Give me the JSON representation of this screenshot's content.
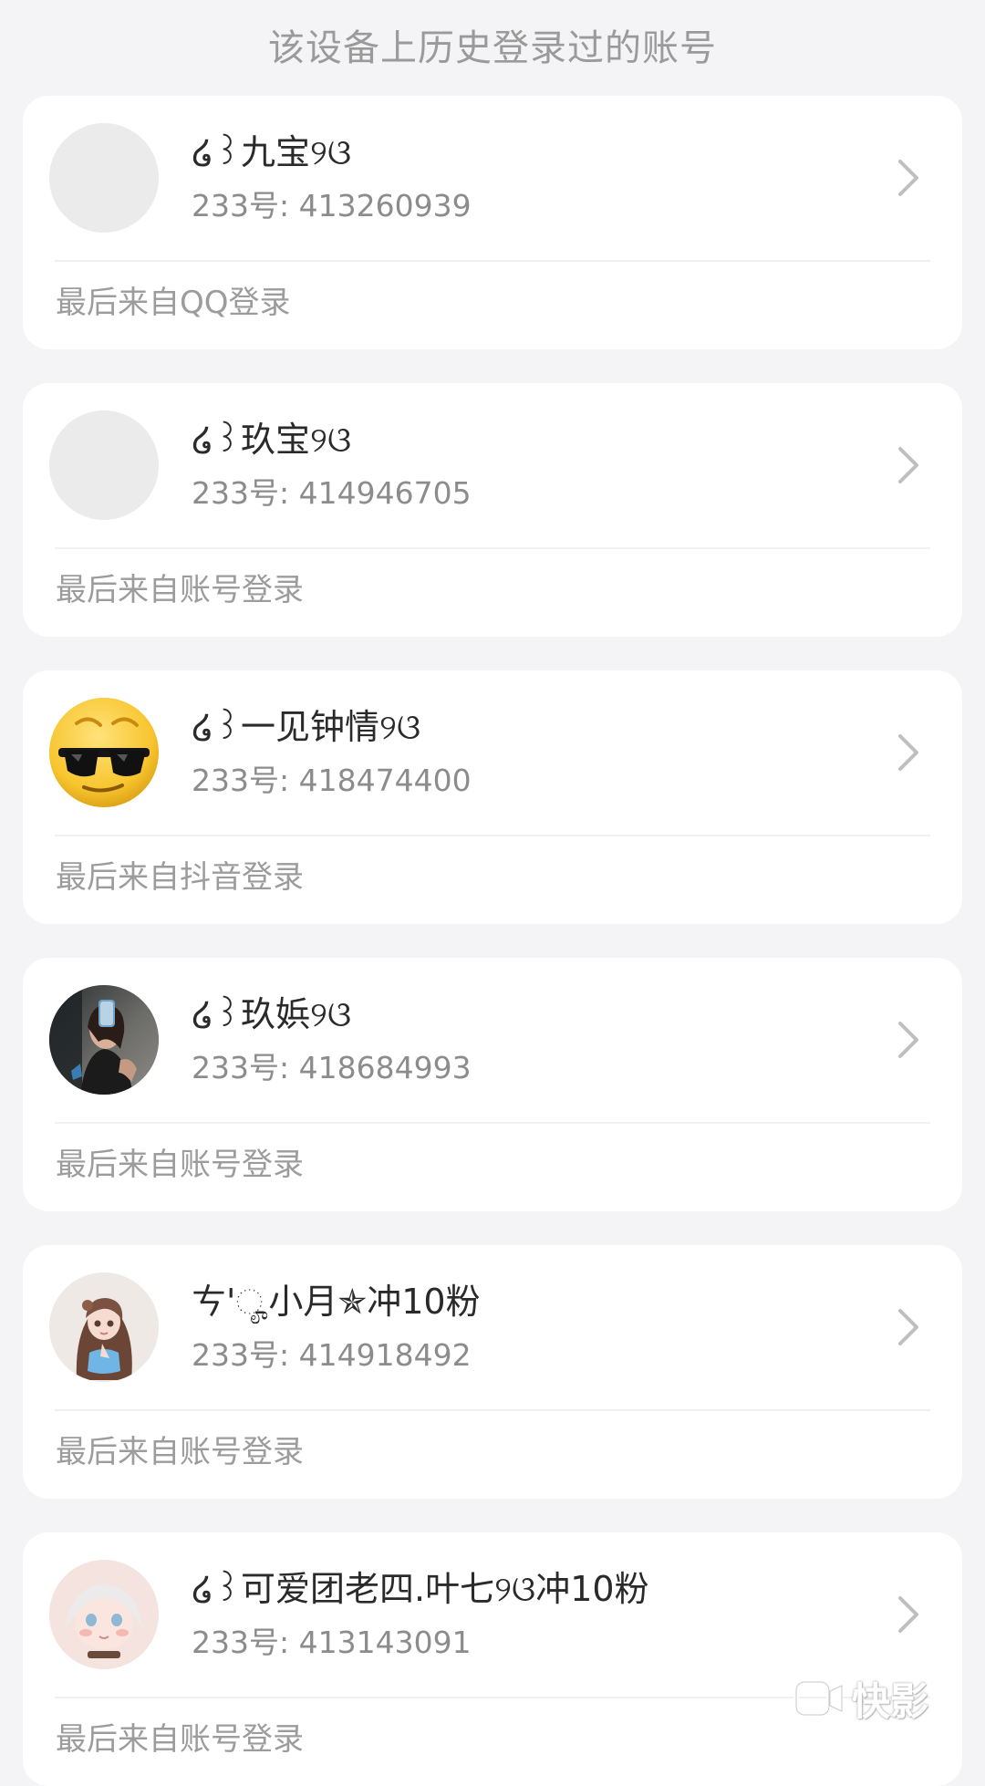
{
  "header": {
    "title": "该设备上历史登录过的账号"
  },
  "accounts": [
    {
      "nickname": "໒꒱九宝୨ଓ",
      "id_label": "233号:",
      "id": "413260939",
      "source": "最后来自QQ登录",
      "avatar": "blank-avatar"
    },
    {
      "nickname": "໒꒱玖宝୨ଓ",
      "id_label": "233号:",
      "id": "414946705",
      "source": "最后来自账号登录",
      "avatar": "blank-avatar"
    },
    {
      "nickname": "໒꒱一见钟情୨ଓ",
      "id_label": "233号:",
      "id": "418474400",
      "source": "最后来自抖音登录",
      "avatar": "sunglasses-emoji"
    },
    {
      "nickname": "໒꒱玖娦୨ଓ",
      "id_label": "233号:",
      "id": "418684993",
      "source": "最后来自账号登录",
      "avatar": "mirror-selfie-photo"
    },
    {
      "nickname": "ㄘ'ೄ小月✯冲10粉",
      "id_label": "233号:",
      "id": "414918492",
      "source": "最后来自账号登录",
      "avatar": "anime-girl-avatar"
    },
    {
      "nickname": "໒꒱可爱团老四.叶七୨ଓ冲10粉",
      "id_label": "233号:",
      "id": "413143091",
      "source": "最后来自账号登录",
      "avatar": "pink-anime-avatar"
    }
  ],
  "icons": {
    "chevron": "chevron-right-icon"
  },
  "watermark": {
    "text": "快影"
  },
  "colors": {
    "background": "#f4f4f6",
    "card": "#ffffff",
    "primary_text": "#2a2a2a",
    "secondary_text": "#8c8c8c",
    "muted_text": "#9c9c9c"
  }
}
